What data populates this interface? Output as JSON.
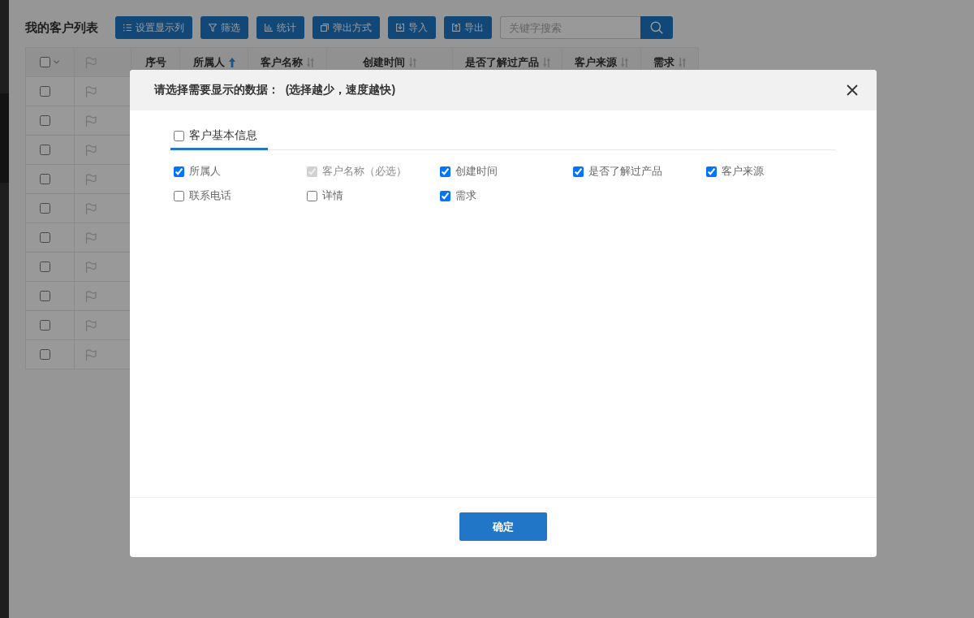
{
  "page": {
    "title": "我的客户列表"
  },
  "toolbar": {
    "buttons": [
      {
        "label": "设置显示列"
      },
      {
        "label": "筛选"
      },
      {
        "label": "统计"
      },
      {
        "label": "弹出方式"
      },
      {
        "label": "导入"
      },
      {
        "label": "导出"
      }
    ],
    "search": {
      "placeholder": "关键字搜索"
    }
  },
  "table": {
    "columns": [
      {
        "kind": "select",
        "checked": false
      },
      {
        "kind": "flag"
      },
      {
        "kind": "text",
        "label": "序号"
      },
      {
        "kind": "sortable",
        "label": "所属人",
        "sorted": true
      },
      {
        "kind": "sortable",
        "label": "客户名称",
        "sorted": false
      },
      {
        "kind": "sortable",
        "label": "创建时间",
        "sorted": false
      },
      {
        "kind": "sortable",
        "label": "是否了解过产品",
        "sorted": false
      },
      {
        "kind": "sortable",
        "label": "客户来源",
        "sorted": false
      },
      {
        "kind": "sortable",
        "label": "需求",
        "sorted": false
      }
    ],
    "rows": [
      {
        "checked": false
      },
      {
        "checked": false
      },
      {
        "checked": false
      },
      {
        "checked": false
      },
      {
        "checked": false
      },
      {
        "checked": false
      },
      {
        "checked": false
      },
      {
        "checked": false
      },
      {
        "checked": false
      },
      {
        "checked": false
      }
    ]
  },
  "dialog": {
    "title": "请选择需要显示的数据：  (选择越少，速度越快)",
    "tabs": [
      {
        "label": "客户基本信息",
        "checked": false,
        "selected": true
      }
    ],
    "options": [
      {
        "label": "所属人",
        "checked": true,
        "disabled": false
      },
      {
        "label": "客户名称（必选）",
        "checked": true,
        "disabled": true
      },
      {
        "label": "创建时间",
        "checked": true,
        "disabled": false
      },
      {
        "label": "是否了解过产品",
        "checked": true,
        "disabled": false
      },
      {
        "label": "客户来源",
        "checked": true,
        "disabled": false
      },
      {
        "label": "联系电话",
        "checked": false,
        "disabled": false
      },
      {
        "label": "详情",
        "checked": false,
        "disabled": false
      },
      {
        "label": "需求",
        "checked": true,
        "disabled": false
      }
    ],
    "confirm_button": "确定"
  }
}
